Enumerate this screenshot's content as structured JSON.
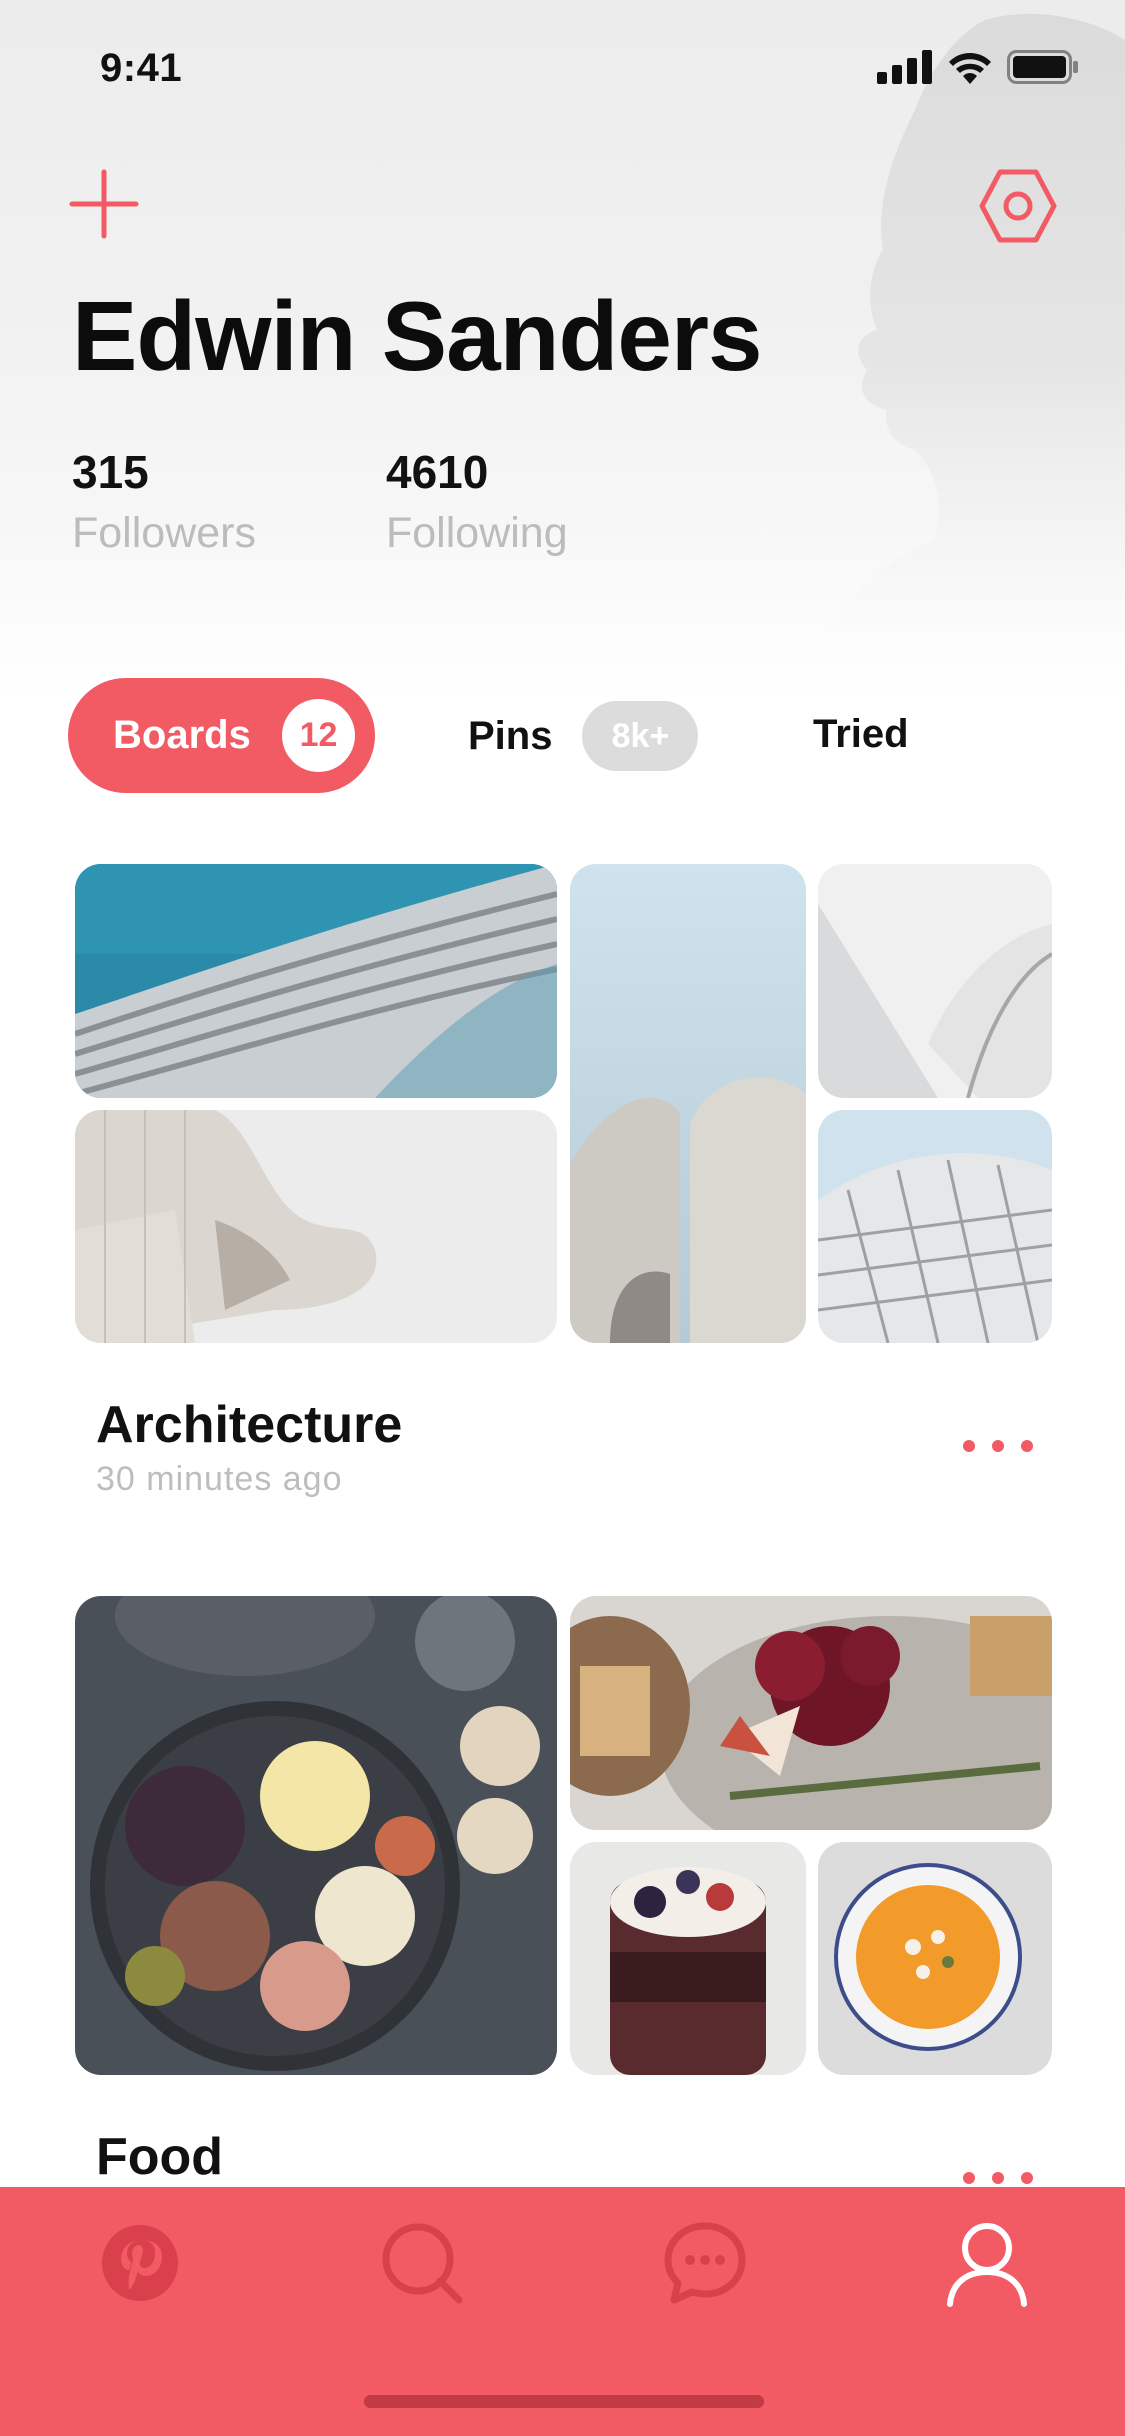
{
  "status_bar": {
    "time": "9:41"
  },
  "profile": {
    "name": "Edwin Sanders",
    "followers_count": "315",
    "followers_label": "Followers",
    "following_count": "4610",
    "following_label": "Following"
  },
  "tabs": [
    {
      "label": "Boards",
      "count": "12",
      "active": true
    },
    {
      "label": "Pins",
      "count": "8k+",
      "active": false
    },
    {
      "label": "Tried",
      "count": "",
      "active": false
    }
  ],
  "boards": [
    {
      "title": "Architecture",
      "updated": "30 minutes ago"
    },
    {
      "title": "Food",
      "updated": ""
    }
  ],
  "bottom_nav": {
    "items": [
      "pinterest-icon",
      "search-icon",
      "chat-icon",
      "profile-icon"
    ],
    "active": "profile-icon"
  },
  "colors": {
    "accent": "#f25a64",
    "muted_text": "#bcbcbc",
    "nav_background": "#f25a64"
  }
}
